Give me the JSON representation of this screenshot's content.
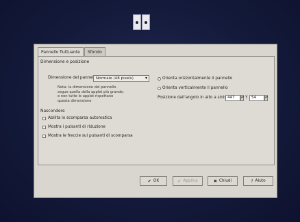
{
  "top_applet": {
    "icon": "panel-applet-icon"
  },
  "tabs": [
    "Pannello fluttuante",
    "Sfondo"
  ],
  "size_position": {
    "group_title": "Dimensione e posizione",
    "size_label": "Dimensione del pannello:",
    "size_value": "Normale (48 pixels)",
    "note": "Nota: la dimensione del pannello segue quella della applet più grande; e non tutte le applet rispettano questa dimensione",
    "orient_horizontal": "Orienta orizzontalmente il pannello",
    "orient_vertical": "Orienta verticalmente il pannello",
    "position_label": "Posizione dall'angolo in alto a sinistra: X",
    "x_value": "447",
    "y_label": "Y",
    "y_value": "54"
  },
  "hide": {
    "group_title": "Nascondere",
    "auto_hide": "Abilita lo scomparsa automatica",
    "show_shrink_buttons": "Mostra i pulsanti di riduzione",
    "show_arrows": "Mostra le freccie sui pulsanti di scomparsa"
  },
  "buttons": {
    "ok": "OK",
    "apply": "Applica",
    "close": "Chiudi",
    "help": "Aiuto"
  }
}
